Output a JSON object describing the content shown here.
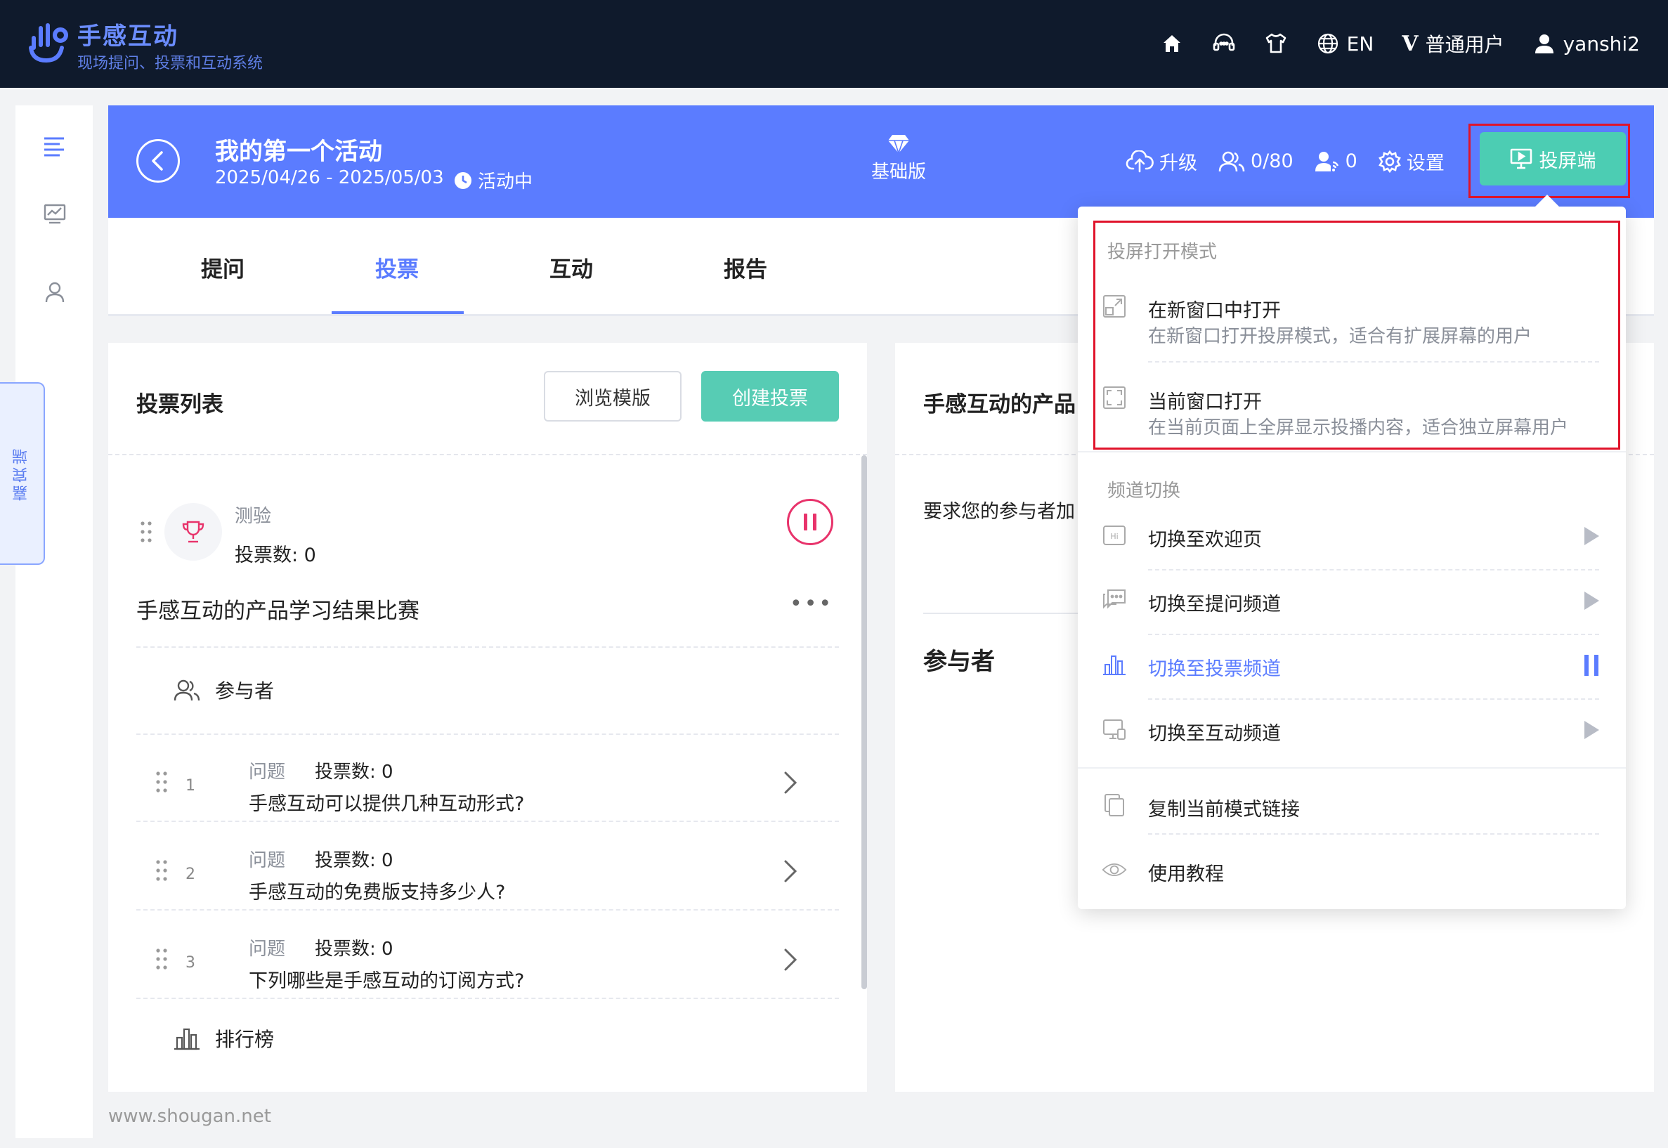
{
  "app": {
    "brand_name": "手感互动",
    "brand_sub": "现场提问、投票和互动系统",
    "brand_color": "#5b7cff"
  },
  "topbar": {
    "icons": [
      "home-icon",
      "headset-icon",
      "tshirt-icon",
      "globe-icon",
      "user-icon"
    ],
    "language": "EN",
    "user_level": "普通用户",
    "username": "yanshi2"
  },
  "sidebar": {
    "icons": [
      "list-icon",
      "chart-icon",
      "user-icon"
    ],
    "guest_tab": "嘉宾端"
  },
  "activity": {
    "title": "我的第一个活动",
    "date_range": "2025/04/26 - 2025/05/03",
    "status": "活动中",
    "plan": "基础版",
    "upgrade": "升级",
    "participants": "0/80",
    "online": "0",
    "settings": "设置",
    "projector_button": "投屏端"
  },
  "tabs": [
    {
      "label": "提问",
      "active": false
    },
    {
      "label": "投票",
      "active": true
    },
    {
      "label": "互动",
      "active": false
    },
    {
      "label": "报告",
      "active": false
    }
  ],
  "vote_panel": {
    "title": "投票列表",
    "browse_label": "浏览模版",
    "create_label": "创建投票",
    "quiz_tag": "测验",
    "quiz_count": "投票数: 0",
    "vote_name": "手感互动的产品学习结果比赛",
    "more": "•••",
    "participants_label": "参与者",
    "questions": [
      {
        "num": "1",
        "type": "问题",
        "count": "投票数: 0",
        "text": "手感互动可以提供几种互动形式?"
      },
      {
        "num": "2",
        "type": "问题",
        "count": "投票数: 0",
        "text": "手感互动的免费版支持多少人?"
      },
      {
        "num": "3",
        "type": "问题",
        "count": "投票数: 0",
        "text": "下列哪些是手感互动的订阅方式?"
      }
    ],
    "leaderboard_label": "排行榜"
  },
  "detail_panel": {
    "title": "手感互动的产品",
    "description": "要求您的参与者加",
    "participants_heading": "参与者"
  },
  "menu": {
    "open_mode_header": "投屏打开模式",
    "new_window": {
      "label": "在新窗口中打开",
      "sub": "在新窗口打开投屏模式，适合有扩展屏幕的用户"
    },
    "current_window": {
      "label": "当前窗口打开",
      "sub": "在当前页面上全屏显示投播内容，适合独立屏幕用户"
    },
    "channel_header": "频道切换",
    "channels": [
      {
        "label": "切换至欢迎页",
        "icon": "hi-icon",
        "active": false
      },
      {
        "label": "切换至提问频道",
        "icon": "chat-icon",
        "active": false
      },
      {
        "label": "切换至投票频道",
        "icon": "bar-chart-icon",
        "active": true
      },
      {
        "label": "切换至互动频道",
        "icon": "screen-icon",
        "active": false
      }
    ],
    "copy_link": "复制当前模式链接",
    "tutorial": "使用教程"
  },
  "footer": {
    "url": "www.shougan.net"
  }
}
